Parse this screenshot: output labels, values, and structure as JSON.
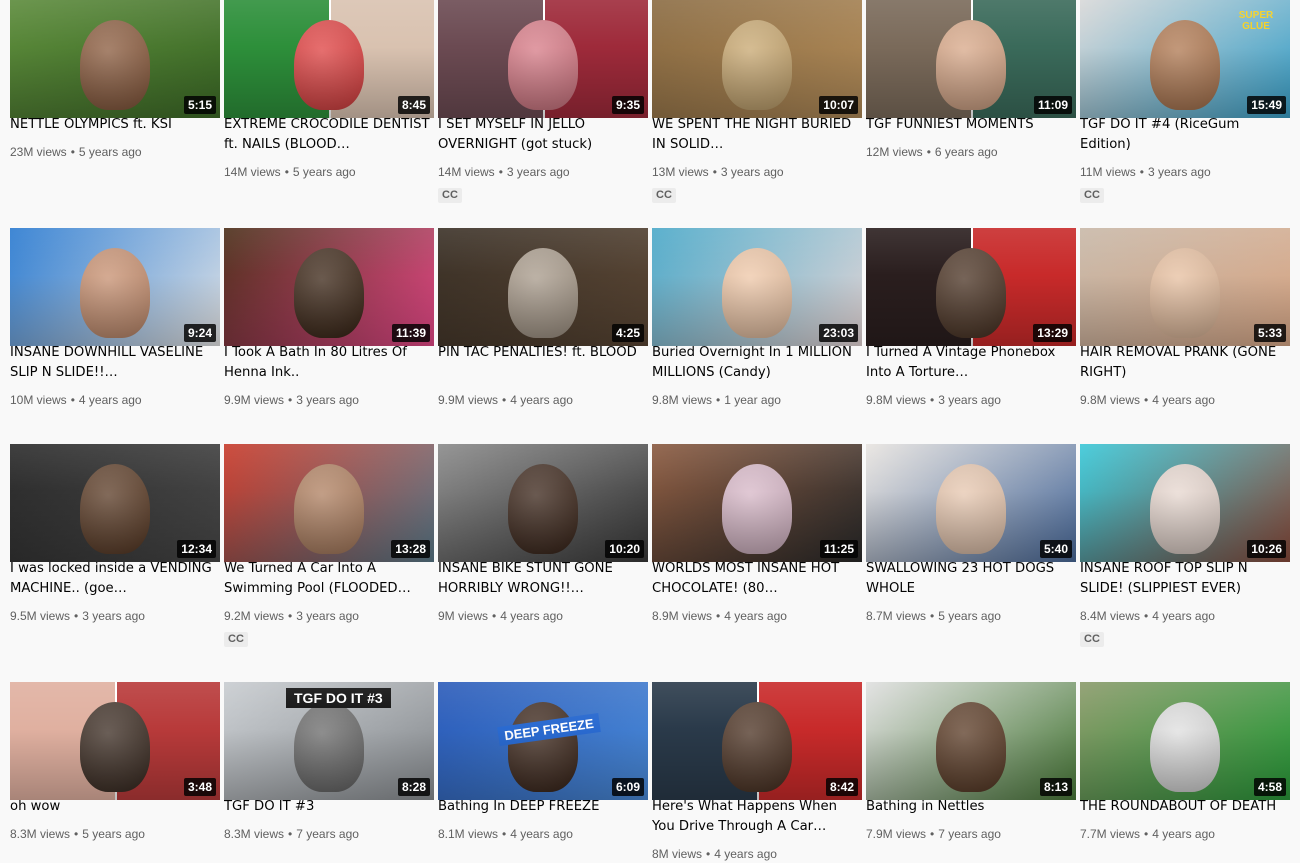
{
  "videos": [
    {
      "title": "NETTLE OLYMPICS ft. KSI",
      "views": "23M views",
      "age": "5 years ago",
      "duration": "5:15",
      "cc": "",
      "colors": [
        "#5b8a3a",
        "#3d6b27"
      ],
      "figure": "#8a5a3c"
    },
    {
      "title": "EXTREME CROCODILE DENTIST ft. NAILS (BLOOD…",
      "views": "14M views",
      "age": "5 years ago",
      "duration": "8:45",
      "cc": "",
      "colors": [
        "#2d8f3a",
        "#d9c2b0"
      ],
      "figure": "#e04040"
    },
    {
      "title": "I SET MYSELF IN JELLO OVERNIGHT (got stuck)",
      "views": "14M views",
      "age": "3 years ago",
      "duration": "9:35",
      "cc": "CC",
      "colors": [
        "#6b4a52",
        "#9e2a3a"
      ],
      "figure": "#d87a86"
    },
    {
      "title": "WE SPENT THE NIGHT BURIED IN SOLID…",
      "views": "13M views",
      "age": "3 years ago",
      "duration": "10:07",
      "cc": "CC",
      "colors": [
        "#8a6b42",
        "#b08a58"
      ],
      "figure": "#c9a870"
    },
    {
      "title": "TGF FUNNIEST MOMENTS",
      "views": "12M views",
      "age": "6 years ago",
      "duration": "11:09",
      "cc": "",
      "colors": [
        "#7a6a5a",
        "#3a6a5a"
      ],
      "figure": "#d9a888"
    },
    {
      "title": "TGF DO IT #4 (RiceGum Edition)",
      "views": "11M views",
      "age": "3 years ago",
      "duration": "15:49",
      "cc": "CC",
      "colors": [
        "#d8d8d8",
        "#3aa0c8"
      ],
      "figure": "#b07850",
      "overlay": "SUPER GLUE"
    },
    {
      "title": "INSANE DOWNHILL VASELINE SLIP N SLIDE!!…",
      "views": "10M views",
      "age": "4 years ago",
      "duration": "9:24",
      "cc": "",
      "colors": [
        "#2a7ad0",
        "#e8e8e8"
      ],
      "figure": "#c89070"
    },
    {
      "title": "I Took A Bath In 80 Litres Of Henna Ink..",
      "views": "9.9M views",
      "age": "3 years ago",
      "duration": "11:39",
      "cc": "",
      "colors": [
        "#4a2e18",
        "#e84a8a"
      ],
      "figure": "#3a2414"
    },
    {
      "title": "PIN TAC PENALTIES! ft. BLOOD",
      "views": "9.9M views",
      "age": "4 years ago",
      "duration": "4:25",
      "cc": "",
      "colors": [
        "#3a3026",
        "#5a4634"
      ],
      "figure": "#a89a8a"
    },
    {
      "title": "Buried Overnight In 1 MILLION MILLIONS (Candy)",
      "views": "9.8M views",
      "age": "1 year ago",
      "duration": "23:03",
      "cc": "",
      "colors": [
        "#4aa8c8",
        "#e8d8d8"
      ],
      "figure": "#f0c8a8"
    },
    {
      "title": "I Turned A Vintage Phonebox Into A Torture…",
      "views": "9.8M views",
      "age": "3 years ago",
      "duration": "13:29",
      "cc": "",
      "colors": [
        "#2a1e1e",
        "#c82a2a"
      ],
      "figure": "#4a3222"
    },
    {
      "title": "HAIR REMOVAL PRANK (GONE RIGHT)",
      "views": "9.8M views",
      "age": "4 years ago",
      "duration": "5:33",
      "cc": "",
      "colors": [
        "#c8b8a8",
        "#d8a888"
      ],
      "figure": "#e8c0a0"
    },
    {
      "title": "I was locked inside a VENDING MACHINE.. (goe…",
      "views": "9.5M views",
      "age": "3 years ago",
      "duration": "12:34",
      "cc": "",
      "colors": [
        "#2a2a2a",
        "#484848"
      ],
      "figure": "#5a3a24"
    },
    {
      "title": "We Turned A Car Into A Swimming Pool (FLOODED…",
      "views": "9.2M views",
      "age": "3 years ago",
      "duration": "13:28",
      "cc": "CC",
      "colors": [
        "#c83a2a",
        "#5a7a8a"
      ],
      "figure": "#b08060"
    },
    {
      "title": "INSANE BIKE STUNT GONE HORRIBLY WRONG!!…",
      "views": "9M views",
      "age": "4 years ago",
      "duration": "10:20",
      "cc": "",
      "colors": [
        "#8a8a8a",
        "#3a3a3a"
      ],
      "figure": "#3a2418"
    },
    {
      "title": "WORLDS MOST INSANE HOT CHOCOLATE! (80…",
      "views": "8.9M views",
      "age": "4 years ago",
      "duration": "11:25",
      "cc": "",
      "colors": [
        "#8a5a40",
        "#2a2a2a"
      ],
      "figure": "#d8b8c8"
    },
    {
      "title": "SWALLOWING 23 HOT DOGS WHOLE",
      "views": "8.7M views",
      "age": "5 years ago",
      "duration": "5:40",
      "cc": "",
      "colors": [
        "#e8e4e0",
        "#4a6a9a"
      ],
      "figure": "#e8c8b0"
    },
    {
      "title": "INSANE ROOF TOP SLIP N SLIDE! (SLIPPIEST EVER)",
      "views": "8.4M views",
      "age": "4 years ago",
      "duration": "10:26",
      "cc": "CC",
      "colors": [
        "#3ac8d8",
        "#8a4a3a"
      ],
      "figure": "#e8d8d0"
    },
    {
      "title": "oh wow",
      "views": "8.3M views",
      "age": "5 years ago",
      "duration": "3:48",
      "cc": "",
      "colors": [
        "#e0b0a0",
        "#b83a3a"
      ],
      "figure": "#3a2a20"
    },
    {
      "title": "TGF DO IT #3",
      "views": "8.3M views",
      "age": "7 years ago",
      "duration": "8:28",
      "cc": "",
      "colors": [
        "#c8ccd0",
        "#8a8e92"
      ],
      "figure": "#6a6a6a",
      "overlay": "TGF DO IT #3"
    },
    {
      "title": "Bathing In DEEP FREEZE",
      "views": "8.1M views",
      "age": "4 years ago",
      "duration": "6:09",
      "cc": "",
      "colors": [
        "#2a5ab8",
        "#4a8ad8"
      ],
      "figure": "#3a2418",
      "overlay": "DEEP FREEZE"
    },
    {
      "title": "Here's What Happens When You Drive Through A Car…",
      "views": "8M views",
      "age": "4 years ago",
      "duration": "8:42",
      "cc": "",
      "colors": [
        "#2a3a4a",
        "#c82a2a"
      ],
      "figure": "#4a3020"
    },
    {
      "title": "Bathing in Nettles",
      "views": "7.9M views",
      "age": "7 years ago",
      "duration": "8:13",
      "cc": "",
      "colors": [
        "#e0e0e0",
        "#4a7a3a"
      ],
      "figure": "#5a3a24"
    },
    {
      "title": "THE ROUNDABOUT OF DEATH",
      "views": "7.7M views",
      "age": "4 years ago",
      "duration": "4:58",
      "cc": "",
      "colors": [
        "#8a9a6a",
        "#2a9a3a"
      ],
      "figure": "#e0e0e0"
    }
  ]
}
